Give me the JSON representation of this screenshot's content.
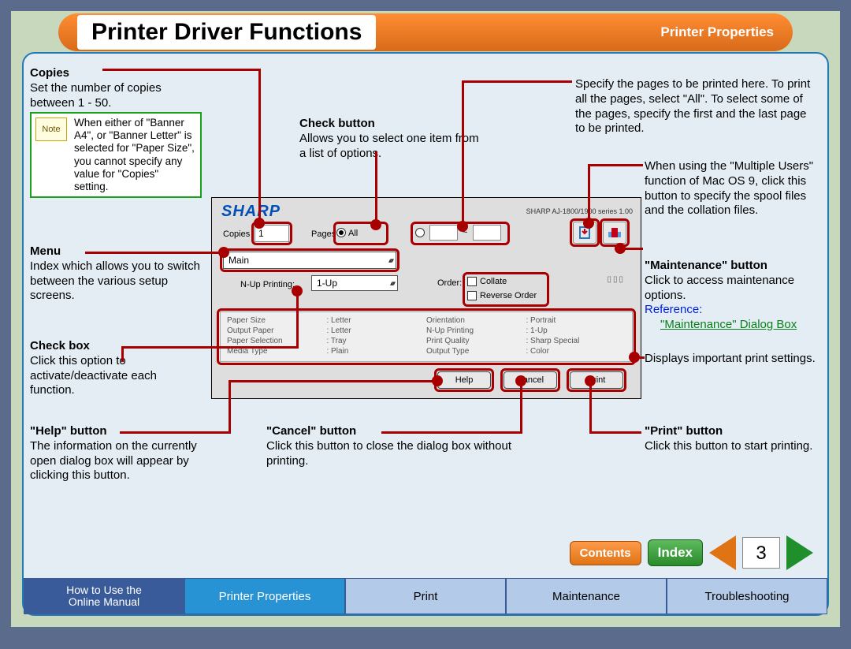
{
  "title": "Printer Driver Functions",
  "section": "Printer Properties",
  "annotations": {
    "copies": {
      "title": "Copies",
      "body": "Set the number of copies between 1 - 50."
    },
    "note": {
      "label": "Note",
      "body": "When either of \"Banner A4\", or \"Banner Letter\" is selected for \"Paper Size\", you cannot specify any value for \"Copies\" setting."
    },
    "menu": {
      "title": "Menu",
      "body": "Index which allows you to switch between the various setup screens."
    },
    "checkbox": {
      "title": "Check box",
      "body": "Click this option to activate/deactivate each function."
    },
    "help": {
      "title": "\"Help\" button",
      "body": "The information on the currently open dialog box will appear by clicking this button."
    },
    "checkbtn": {
      "title": "Check button",
      "body": "Allows you to select one item from a list of options."
    },
    "cancel": {
      "title": "\"Cancel\" button",
      "body": "Click this button to close the dialog box without printing."
    },
    "pages": {
      "body": "Specify the pages to be printed here. To print all the pages, select \"All\". To select some of the pages, specify the first and the last page to be printed."
    },
    "spool": {
      "body": "When using the \"Multiple Users\" function of Mac OS 9, click this button to specify the spool files and the collation files."
    },
    "maintenance": {
      "title": "\"Maintenance\" button",
      "body": "Click to access maintenance options.",
      "ref_label": "Reference:",
      "ref_link": "\"Maintenance\" Dialog Box"
    },
    "settings_disp": {
      "body": "Displays important print settings."
    },
    "print": {
      "title": "\"Print\" button",
      "body": "Click this button to start printing."
    }
  },
  "dialog": {
    "brand_1": "SH",
    "brand_2": "ARP",
    "series": "SHARP AJ-1800/1900 series 1.00",
    "copies_label": "Copies",
    "copies_value": "1",
    "pages_label": "Pages",
    "pages_all": "All",
    "pages_tilde": "~",
    "menu_value": "Main",
    "nup_label": "N-Up Printing:",
    "nup_value": "1-Up",
    "order_label": "Order:",
    "collate_label": "Collate",
    "reverse_label": "Reverse Order",
    "settings": [
      [
        "Paper Size",
        ": Letter",
        "Orientation",
        ": Portrait"
      ],
      [
        "Output Paper",
        ": Letter",
        "N-Up Printing",
        ": 1-Up"
      ],
      [
        "Paper Selection",
        ": Tray",
        "Print Quality",
        ": Sharp Special"
      ],
      [
        "Media Type",
        ": Plain",
        "Output Type",
        ": Color"
      ]
    ],
    "help_btn": "Help",
    "cancel_btn": "Cancel",
    "print_btn": "Print"
  },
  "pager": {
    "contents": "Contents",
    "index": "Index",
    "page": "3"
  },
  "tabs": {
    "howto_1": "How to Use the",
    "howto_2": "Online Manual",
    "props": "Printer Properties",
    "print": "Print",
    "maint": "Maintenance",
    "trouble": "Troubleshooting"
  }
}
